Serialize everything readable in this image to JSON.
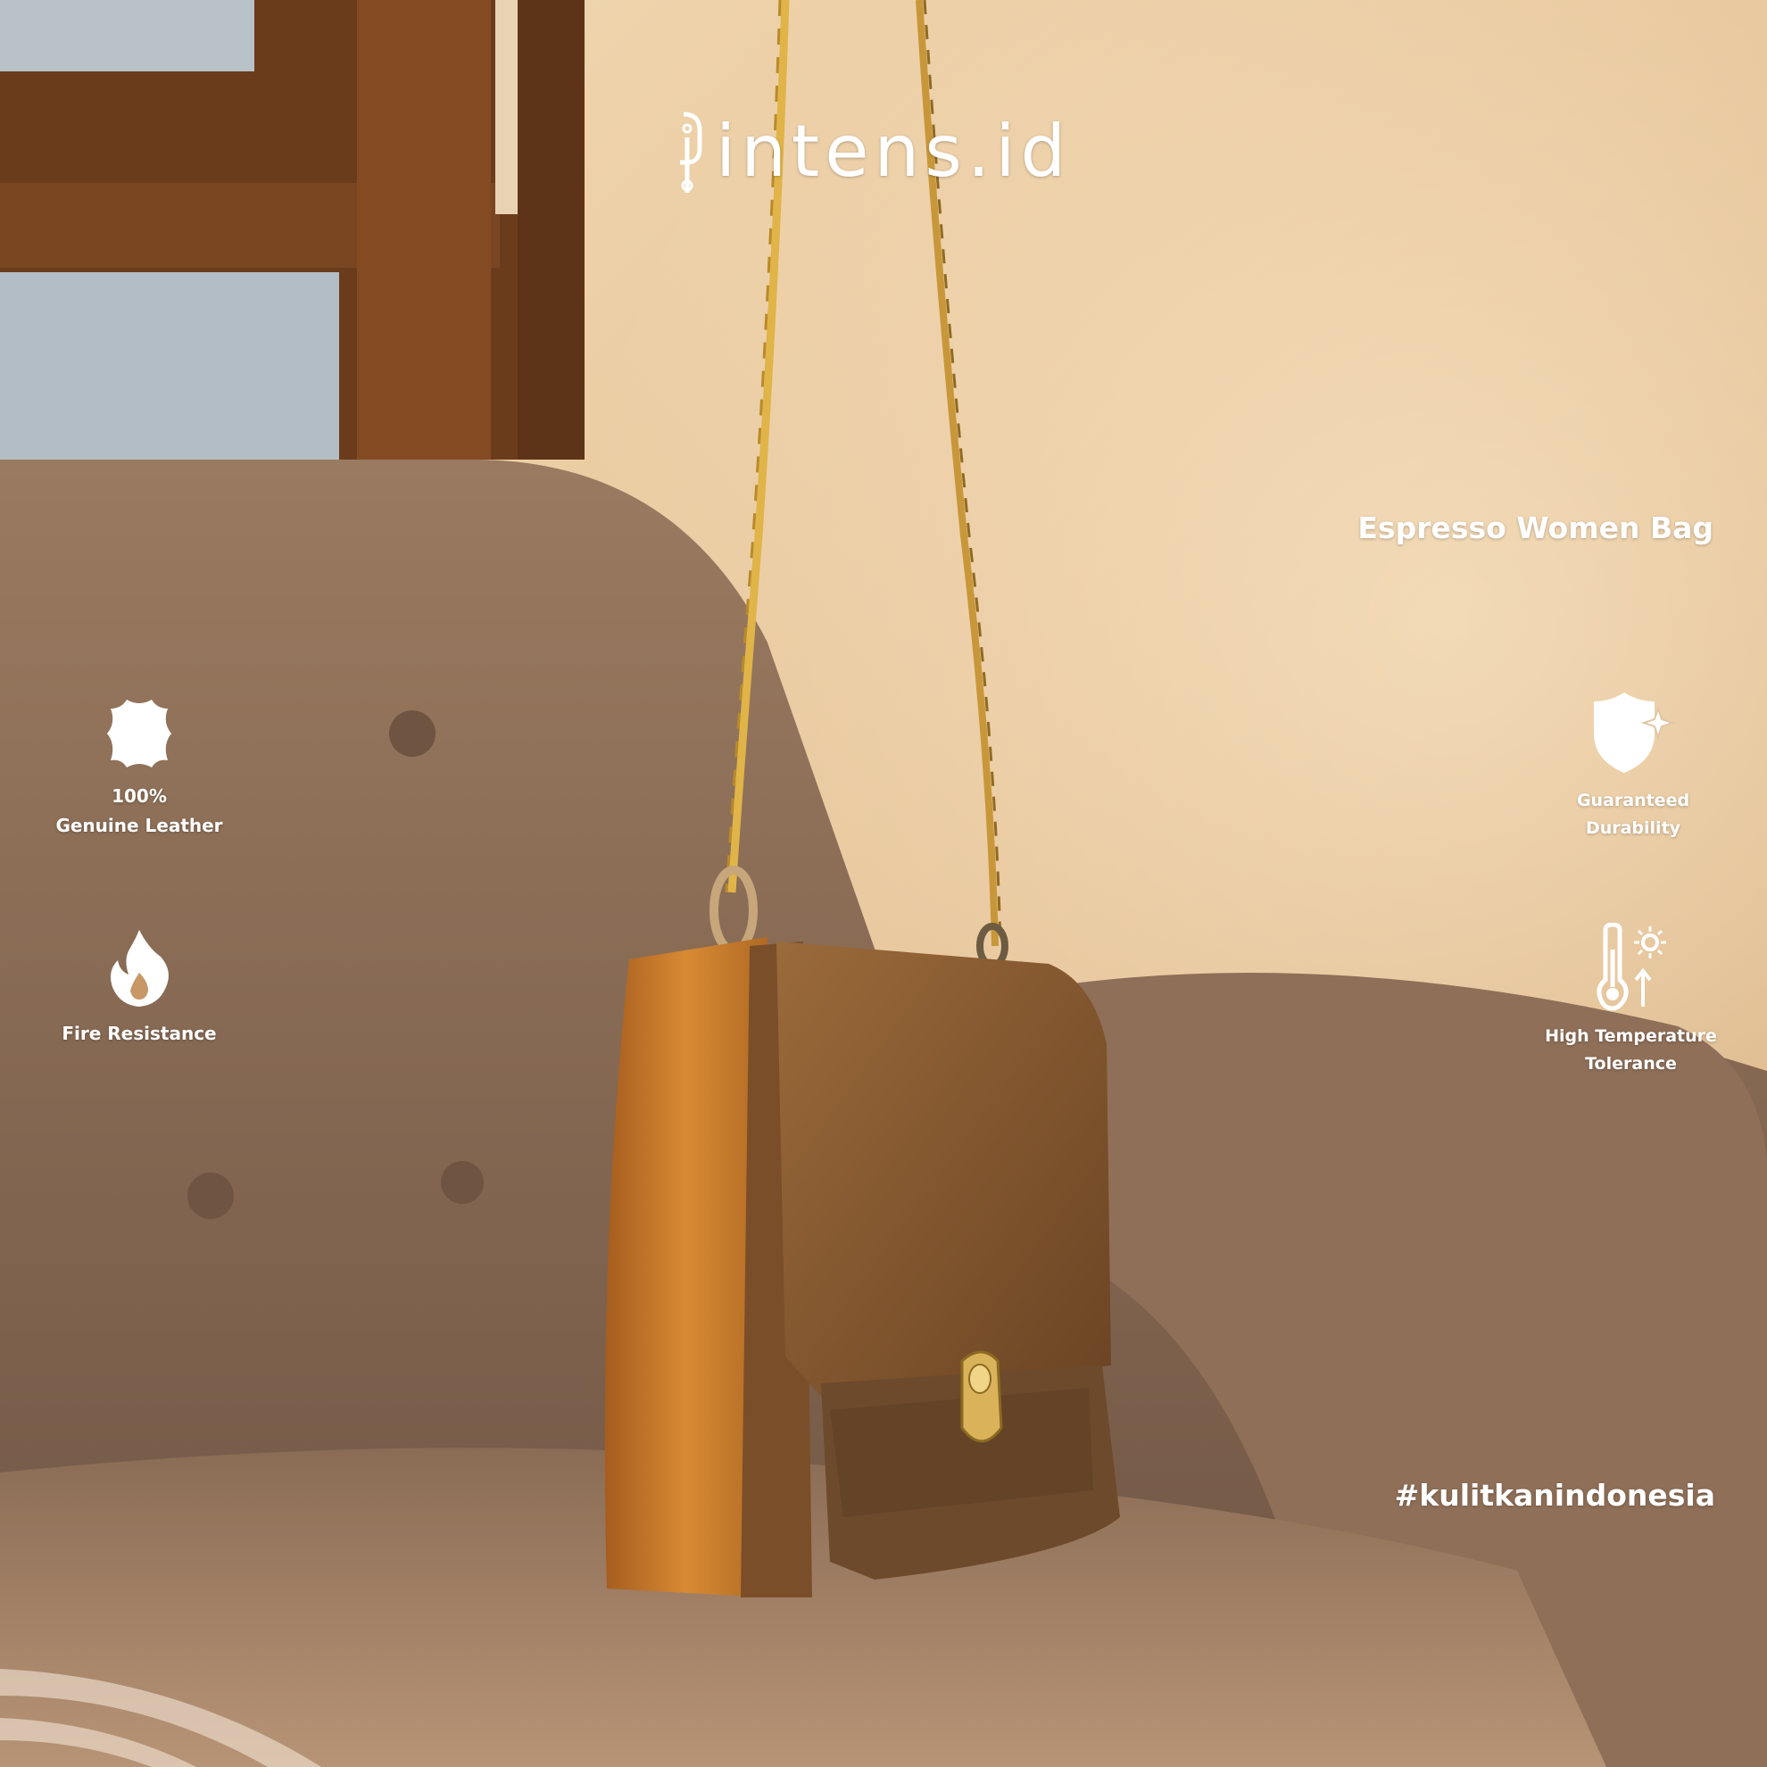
{
  "brand": {
    "name": "intens.id"
  },
  "product": {
    "title": "Espresso Women Bag"
  },
  "features": [
    {
      "icon": "leather-hide-icon",
      "line1": "100%",
      "line2": "Genuine Leather"
    },
    {
      "icon": "flame-icon",
      "line1": "Fire Resistance",
      "line2": ""
    },
    {
      "icon": "shield-sparkle-icon",
      "line1": "Guaranteed",
      "line2": "Durability"
    },
    {
      "icon": "thermometer-sun-icon",
      "line1": "High Temperature",
      "line2": "Tolerance"
    }
  ],
  "hashtag": "#kulitkanindonesia",
  "colors": {
    "overlay_text": "#ffffff",
    "wall": "#e8c9a0",
    "sofa": "#8c6e56",
    "bag": "#8a5a2e",
    "chain": "#d9a83a"
  }
}
